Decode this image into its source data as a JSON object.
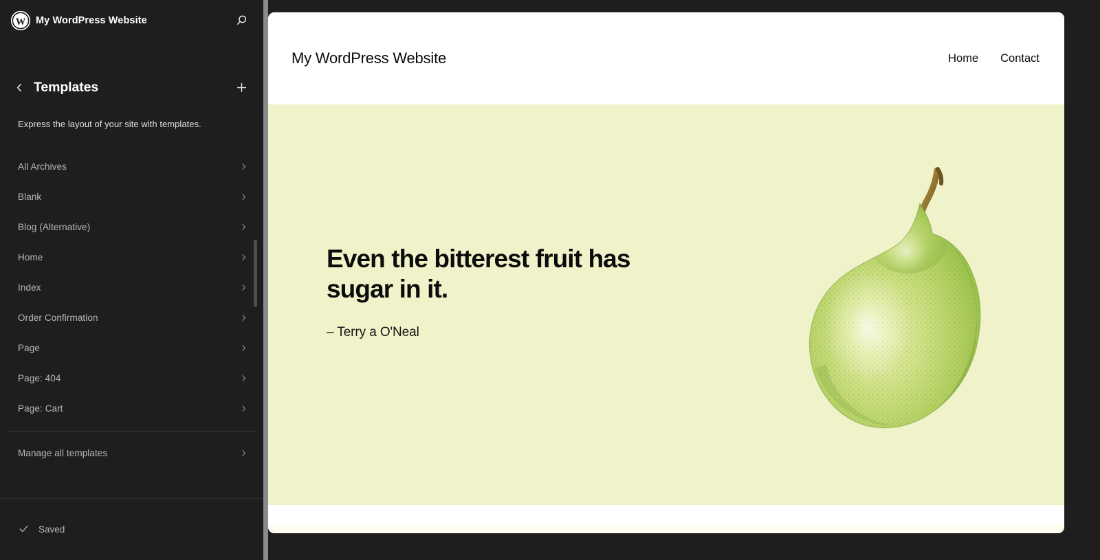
{
  "editor": {
    "brand_icon": "wordpress-logo-icon",
    "site_name": "My WordPress Website",
    "search_icon": "search-icon",
    "back_icon": "chevron-left-icon",
    "add_icon": "plus-icon",
    "panel_title": "Templates",
    "panel_description": "Express the layout of your site with templates.",
    "chevron_icon": "chevron-right-icon",
    "templates": [
      {
        "label": "All Archives"
      },
      {
        "label": "Blank"
      },
      {
        "label": "Blog (Alternative)"
      },
      {
        "label": "Home"
      },
      {
        "label": "Index"
      },
      {
        "label": "Order Confirmation"
      },
      {
        "label": "Page"
      },
      {
        "label": "Page: 404"
      },
      {
        "label": "Page: Cart"
      }
    ],
    "manage_all": {
      "label": "Manage all templates"
    },
    "status": {
      "check_icon": "checkmark-icon",
      "label": "Saved"
    },
    "colors": {
      "sidebar_bg": "#1e1e1e",
      "sidebar_text": "#b8b8b8",
      "edge_strip": "#8a8a8a",
      "accent_white": "#ffffff"
    }
  },
  "preview": {
    "site_title": "My WordPress Website",
    "nav": [
      {
        "label": "Home"
      },
      {
        "label": "Contact"
      }
    ],
    "hero": {
      "quote": "Even the bitterest fruit has sugar in it.",
      "attribution": "– Terry a O'Neal",
      "image_icon": "pear-illustration",
      "background_color": "#f0f2c9",
      "footer_color": "#fdfcef"
    }
  }
}
